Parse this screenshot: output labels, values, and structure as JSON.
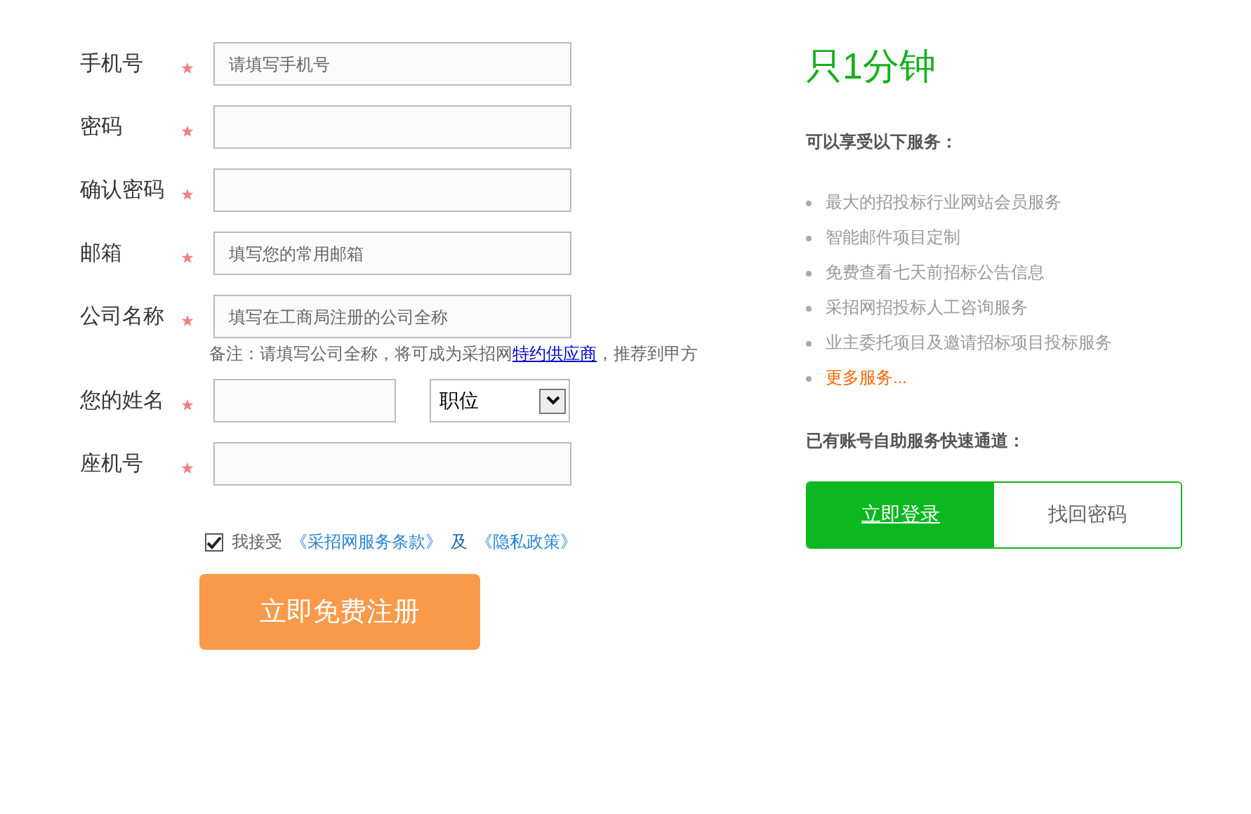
{
  "form": {
    "fields": [
      {
        "kind": "text",
        "label": "手机号",
        "required": true,
        "placeholder": "请填写手机号"
      },
      {
        "kind": "text",
        "label": "密码",
        "required": true
      },
      {
        "kind": "text",
        "label": "确认密码",
        "required": true
      },
      {
        "kind": "text",
        "label": "邮箱",
        "required": true,
        "placeholder": "填写您的常用邮箱"
      },
      {
        "kind": "text",
        "label": "公司名称",
        "required": true,
        "placeholder": "填写在工商局注册的公司全称",
        "note": {
          "before": "备注：请填写公司全称，将可成为采招网",
          "link": "特约供应商",
          "after": "，推荐到甲方"
        }
      },
      {
        "kind": "name",
        "label": "您的姓名",
        "required": true,
        "select": "职位"
      },
      {
        "kind": "text",
        "label": "座机号",
        "required": true
      }
    ],
    "agreement": {
      "checked": true,
      "text": "我接受",
      "terms": "《采招网服务条款》",
      "and": "及",
      "privacy": "《隐私政策》"
    },
    "submit": "立即免费注册"
  },
  "aside": {
    "title": "只1分钟",
    "subtitle": "可以享受以下服务：",
    "services": [
      {
        "kind": "plain",
        "text": "最大的招投标行业网站会员服务"
      },
      {
        "kind": "plain",
        "text": "智能邮件项目定制"
      },
      {
        "kind": "plain",
        "text": "免费查看七天前招标公告信息"
      },
      {
        "kind": "plain",
        "text": "采招网招投标人工咨询服务"
      },
      {
        "kind": "plain",
        "text": "业主委托项目及邀请招标项目投标服务"
      },
      {
        "kind": "more",
        "text": "更多服务..."
      }
    ],
    "quick_title": "已有账号自助服务快速通道：",
    "quick_buttons": [
      {
        "label": "立即登录",
        "selected": true
      },
      {
        "label": "找回密码",
        "selected": false
      }
    ]
  }
}
